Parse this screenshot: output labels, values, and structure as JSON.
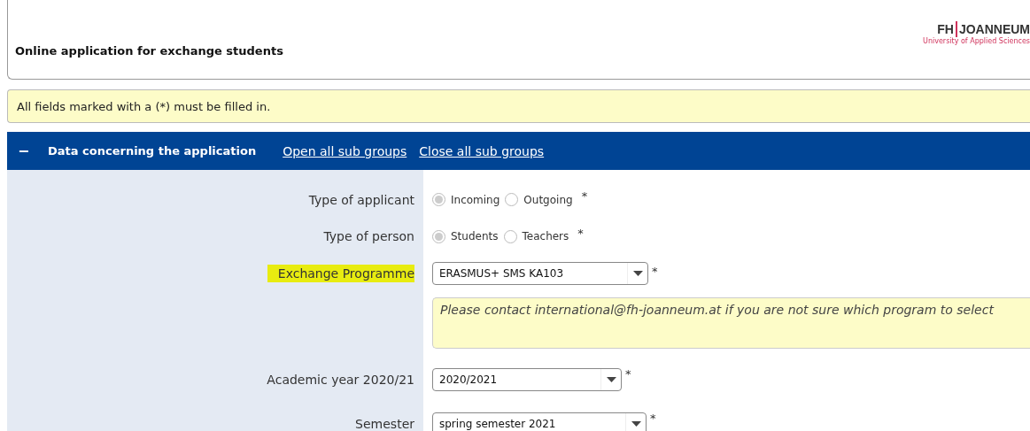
{
  "header": {
    "title": "Online application for exchange students",
    "logo": {
      "left": "FH",
      "right": "JOANNEUM",
      "tagline": "University of Applied Sciences"
    }
  },
  "notice": "All fields marked with a (*) must be filled in.",
  "section": {
    "expanded": true,
    "toggle": "−",
    "title": "Data concerning the application",
    "links": [
      "Open all sub groups",
      "Close all sub groups"
    ]
  },
  "fields": [
    {
      "kind": "radio",
      "label": "Type of applicant",
      "highlighted": false,
      "required": "*",
      "options": [
        {
          "label": "Incoming",
          "selected": true
        },
        {
          "label": "Outgoing",
          "selected": false
        }
      ]
    },
    {
      "kind": "radio",
      "label": "Type of person",
      "highlighted": false,
      "required": "*",
      "options": [
        {
          "label": "Students",
          "selected": true
        },
        {
          "label": "Teachers",
          "selected": false
        }
      ]
    },
    {
      "kind": "select",
      "label": "Exchange Programme",
      "highlighted": true,
      "required": "*",
      "value": "ERASMUS+ SMS KA103"
    },
    {
      "kind": "hint",
      "text": "Please contact international@fh-joanneum.at if you are not sure which program to select"
    },
    {
      "kind": "select",
      "label": "Academic year 2020/21",
      "highlighted": false,
      "required": "*",
      "value": "2020/2021"
    },
    {
      "kind": "select",
      "label": "Semester",
      "highlighted": false,
      "required": "*",
      "value": "spring semester 2021"
    }
  ]
}
